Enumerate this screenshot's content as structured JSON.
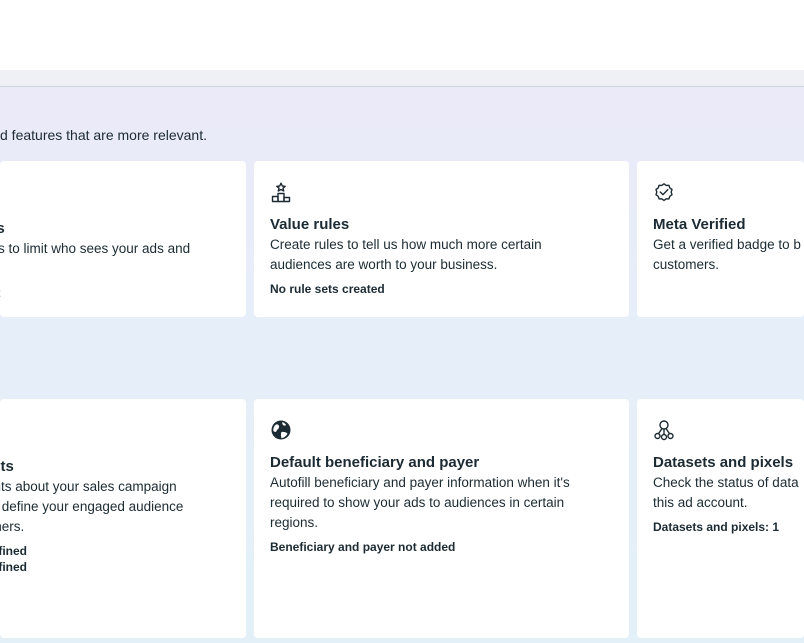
{
  "section_subtitle": "d features that are more relevant.",
  "row1": {
    "card_left": {
      "title": "ols",
      "description_line1": "rols to limit who sees your ads and",
      "description_line2": "r.",
      "status": "set"
    },
    "card_value_rules": {
      "icon": "podium-star-icon",
      "title": "Value rules",
      "description_line1": "Create rules to tell us how much more certain",
      "description_line2": "audiences are worth to your business.",
      "status": "No rule sets created"
    },
    "card_meta_verified": {
      "icon": "verified-badge-icon",
      "title": "Meta Verified",
      "description_line1": "Get a verified badge to b",
      "description_line2": "customers."
    }
  },
  "row2": {
    "card_left": {
      "title": "ents",
      "description_line1": "ights about your sales campaign",
      "description_line2": "ou define your engaged audience",
      "description_line3": "omers.",
      "status_line1": "Defined",
      "status_line2": "Defined"
    },
    "card_beneficiary": {
      "icon": "globe-icon",
      "title": "Default beneficiary and payer",
      "description_line1": "Autofill beneficiary and payer information when it's",
      "description_line2": "required to show your ads to audiences in certain",
      "description_line3": "regions.",
      "status": "Beneficiary and payer not added"
    },
    "card_datasets": {
      "icon": "datasets-network-icon",
      "title": "Datasets and pixels",
      "description_line1": "Check the status of data",
      "description_line2": "this ad account.",
      "status": "Datasets and pixels: 1"
    }
  }
}
